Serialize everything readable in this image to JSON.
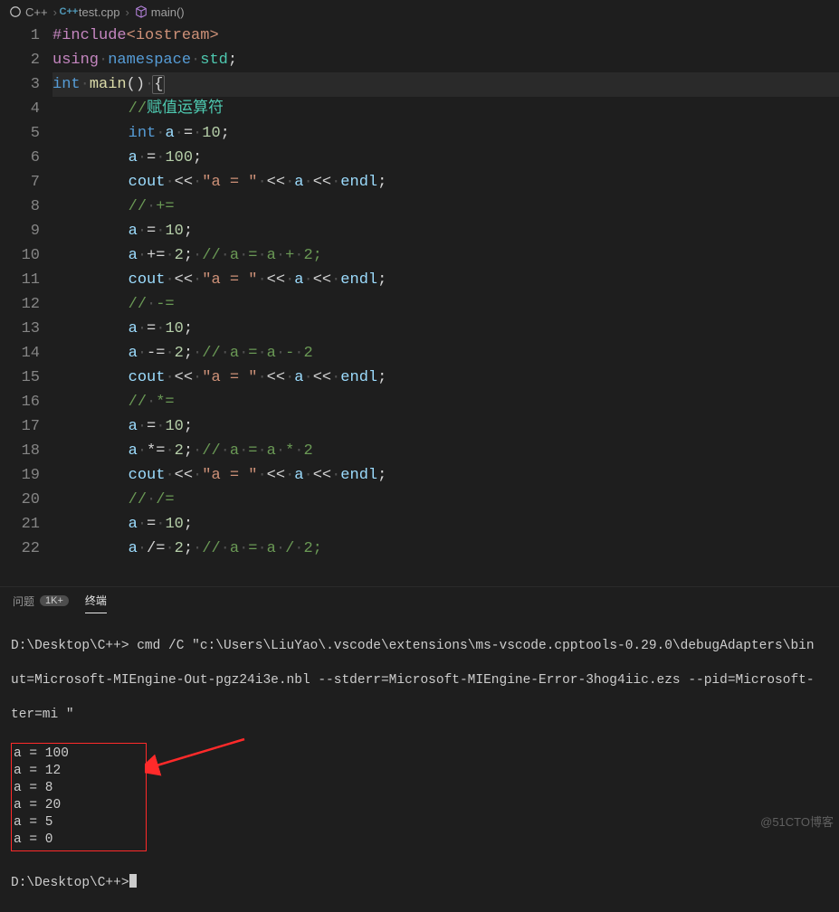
{
  "breadcrumb": {
    "items": [
      {
        "icon": "cpp",
        "label": "C++"
      },
      {
        "icon": "cpp-file",
        "label": "test.cpp"
      },
      {
        "icon": "cube",
        "label": "main()"
      }
    ]
  },
  "editor": {
    "lines": [
      {
        "n": 1,
        "tokens": [
          [
            "pk",
            "#include"
          ],
          [
            "ang",
            "<iostream>"
          ]
        ]
      },
      {
        "n": 2,
        "tokens": [
          [
            "pk",
            "using"
          ],
          [
            "dot",
            "·"
          ],
          [
            "kw",
            "namespace"
          ],
          [
            "dot",
            "·"
          ],
          [
            "ty",
            "std"
          ],
          [
            "pn",
            ";"
          ]
        ]
      },
      {
        "n": 3,
        "tokens": [
          [
            "kw",
            "int"
          ],
          [
            "dot",
            "·"
          ],
          [
            "fn",
            "main"
          ],
          [
            "pn",
            "()"
          ],
          [
            "dot",
            "·"
          ],
          [
            "brmatch",
            "{"
          ]
        ]
      },
      {
        "n": 4,
        "indent": 2,
        "tokens": [
          [
            "cm",
            "//"
          ],
          [
            "cm-cjk",
            "赋值运算符"
          ]
        ]
      },
      {
        "n": 5,
        "indent": 2,
        "tokens": [
          [
            "kw",
            "int"
          ],
          [
            "dot",
            "·"
          ],
          [
            "id",
            "a"
          ],
          [
            "dot",
            "·"
          ],
          [
            "op",
            "="
          ],
          [
            "dot",
            "·"
          ],
          [
            "num",
            "10"
          ],
          [
            "pn",
            ";"
          ]
        ]
      },
      {
        "n": 6,
        "indent": 2,
        "tokens": [
          [
            "id",
            "a"
          ],
          [
            "dot",
            "·"
          ],
          [
            "op",
            "="
          ],
          [
            "dot",
            "·"
          ],
          [
            "num",
            "100"
          ],
          [
            "pn",
            ";"
          ]
        ]
      },
      {
        "n": 7,
        "indent": 2,
        "tokens": [
          [
            "id",
            "cout"
          ],
          [
            "dot",
            "·"
          ],
          [
            "op",
            "<<"
          ],
          [
            "dot",
            "·"
          ],
          [
            "str",
            "\"a = \""
          ],
          [
            "dot",
            "·"
          ],
          [
            "op",
            "<<"
          ],
          [
            "dot",
            "·"
          ],
          [
            "id",
            "a"
          ],
          [
            "dot",
            "·"
          ],
          [
            "op",
            "<<"
          ],
          [
            "dot",
            "·"
          ],
          [
            "id",
            "endl"
          ],
          [
            "pn",
            ";"
          ]
        ]
      },
      {
        "n": 8,
        "indent": 2,
        "tokens": [
          [
            "cm",
            "//"
          ],
          [
            "dot",
            "·"
          ],
          [
            "cm",
            "+="
          ]
        ]
      },
      {
        "n": 9,
        "indent": 2,
        "tokens": [
          [
            "id",
            "a"
          ],
          [
            "dot",
            "·"
          ],
          [
            "op",
            "="
          ],
          [
            "dot",
            "·"
          ],
          [
            "num",
            "10"
          ],
          [
            "pn",
            ";"
          ]
        ]
      },
      {
        "n": 10,
        "indent": 2,
        "tokens": [
          [
            "id",
            "a"
          ],
          [
            "dot",
            "·"
          ],
          [
            "op",
            "+="
          ],
          [
            "dot",
            "·"
          ],
          [
            "num",
            "2"
          ],
          [
            "pn",
            ";"
          ],
          [
            "dot",
            "·"
          ],
          [
            "cm",
            "//"
          ],
          [
            "dot",
            "·"
          ],
          [
            "cm",
            "a"
          ],
          [
            "dot",
            "·"
          ],
          [
            "cm",
            "="
          ],
          [
            "dot",
            "·"
          ],
          [
            "cm",
            "a"
          ],
          [
            "dot",
            "·"
          ],
          [
            "cm",
            "+"
          ],
          [
            "dot",
            "·"
          ],
          [
            "cm",
            "2;"
          ]
        ]
      },
      {
        "n": 11,
        "indent": 2,
        "tokens": [
          [
            "id",
            "cout"
          ],
          [
            "dot",
            "·"
          ],
          [
            "op",
            "<<"
          ],
          [
            "dot",
            "·"
          ],
          [
            "str",
            "\"a = \""
          ],
          [
            "dot",
            "·"
          ],
          [
            "op",
            "<<"
          ],
          [
            "dot",
            "·"
          ],
          [
            "id",
            "a"
          ],
          [
            "dot",
            "·"
          ],
          [
            "op",
            "<<"
          ],
          [
            "dot",
            "·"
          ],
          [
            "id",
            "endl"
          ],
          [
            "pn",
            ";"
          ]
        ]
      },
      {
        "n": 12,
        "indent": 2,
        "tokens": [
          [
            "cm",
            "//"
          ],
          [
            "dot",
            "·"
          ],
          [
            "cm",
            "-="
          ]
        ]
      },
      {
        "n": 13,
        "indent": 2,
        "tokens": [
          [
            "id",
            "a"
          ],
          [
            "dot",
            "·"
          ],
          [
            "op",
            "="
          ],
          [
            "dot",
            "·"
          ],
          [
            "num",
            "10"
          ],
          [
            "pn",
            ";"
          ]
        ]
      },
      {
        "n": 14,
        "indent": 2,
        "tokens": [
          [
            "id",
            "a"
          ],
          [
            "dot",
            "·"
          ],
          [
            "op",
            "-="
          ],
          [
            "dot",
            "·"
          ],
          [
            "num",
            "2"
          ],
          [
            "pn",
            ";"
          ],
          [
            "dot",
            "·"
          ],
          [
            "cm",
            "//"
          ],
          [
            "dot",
            "·"
          ],
          [
            "cm",
            "a"
          ],
          [
            "dot",
            "·"
          ],
          [
            "cm",
            "="
          ],
          [
            "dot",
            "·"
          ],
          [
            "cm",
            "a"
          ],
          [
            "dot",
            "·"
          ],
          [
            "cm",
            "-"
          ],
          [
            "dot",
            "·"
          ],
          [
            "cm",
            "2"
          ]
        ]
      },
      {
        "n": 15,
        "indent": 2,
        "tokens": [
          [
            "id",
            "cout"
          ],
          [
            "dot",
            "·"
          ],
          [
            "op",
            "<<"
          ],
          [
            "dot",
            "·"
          ],
          [
            "str",
            "\"a = \""
          ],
          [
            "dot",
            "·"
          ],
          [
            "op",
            "<<"
          ],
          [
            "dot",
            "·"
          ],
          [
            "id",
            "a"
          ],
          [
            "dot",
            "·"
          ],
          [
            "op",
            "<<"
          ],
          [
            "dot",
            "·"
          ],
          [
            "id",
            "endl"
          ],
          [
            "pn",
            ";"
          ]
        ]
      },
      {
        "n": 16,
        "indent": 2,
        "tokens": [
          [
            "cm",
            "//"
          ],
          [
            "dot",
            "·"
          ],
          [
            "cm",
            "*="
          ]
        ]
      },
      {
        "n": 17,
        "indent": 2,
        "tokens": [
          [
            "id",
            "a"
          ],
          [
            "dot",
            "·"
          ],
          [
            "op",
            "="
          ],
          [
            "dot",
            "·"
          ],
          [
            "num",
            "10"
          ],
          [
            "pn",
            ";"
          ]
        ]
      },
      {
        "n": 18,
        "indent": 2,
        "tokens": [
          [
            "id",
            "a"
          ],
          [
            "dot",
            "·"
          ],
          [
            "op",
            "*="
          ],
          [
            "dot",
            "·"
          ],
          [
            "num",
            "2"
          ],
          [
            "pn",
            ";"
          ],
          [
            "dot",
            "·"
          ],
          [
            "cm",
            "//"
          ],
          [
            "dot",
            "·"
          ],
          [
            "cm",
            "a"
          ],
          [
            "dot",
            "·"
          ],
          [
            "cm",
            "="
          ],
          [
            "dot",
            "·"
          ],
          [
            "cm",
            "a"
          ],
          [
            "dot",
            "·"
          ],
          [
            "cm",
            "*"
          ],
          [
            "dot",
            "·"
          ],
          [
            "cm",
            "2"
          ]
        ]
      },
      {
        "n": 19,
        "indent": 2,
        "tokens": [
          [
            "id",
            "cout"
          ],
          [
            "dot",
            "·"
          ],
          [
            "op",
            "<<"
          ],
          [
            "dot",
            "·"
          ],
          [
            "str",
            "\"a = \""
          ],
          [
            "dot",
            "·"
          ],
          [
            "op",
            "<<"
          ],
          [
            "dot",
            "·"
          ],
          [
            "id",
            "a"
          ],
          [
            "dot",
            "·"
          ],
          [
            "op",
            "<<"
          ],
          [
            "dot",
            "·"
          ],
          [
            "id",
            "endl"
          ],
          [
            "pn",
            ";"
          ]
        ]
      },
      {
        "n": 20,
        "indent": 2,
        "tokens": [
          [
            "cm",
            "//"
          ],
          [
            "dot",
            "·"
          ],
          [
            "cm",
            "/="
          ]
        ]
      },
      {
        "n": 21,
        "indent": 2,
        "tokens": [
          [
            "id",
            "a"
          ],
          [
            "dot",
            "·"
          ],
          [
            "op",
            "="
          ],
          [
            "dot",
            "·"
          ],
          [
            "num",
            "10"
          ],
          [
            "pn",
            ";"
          ]
        ]
      },
      {
        "n": 22,
        "indent": 2,
        "tokens": [
          [
            "id",
            "a"
          ],
          [
            "dot",
            "·"
          ],
          [
            "op",
            "/="
          ],
          [
            "dot",
            "·"
          ],
          [
            "num",
            "2"
          ],
          [
            "pn",
            ";"
          ],
          [
            "dot",
            "·"
          ],
          [
            "cm",
            "//"
          ],
          [
            "dot",
            "·"
          ],
          [
            "cm",
            "a"
          ],
          [
            "dot",
            "·"
          ],
          [
            "cm",
            "="
          ],
          [
            "dot",
            "·"
          ],
          [
            "cm",
            "a"
          ],
          [
            "dot",
            "·"
          ],
          [
            "cm",
            "/"
          ],
          [
            "dot",
            "·"
          ],
          [
            "cm",
            "2;"
          ]
        ]
      }
    ]
  },
  "panel": {
    "tabs": [
      {
        "label": "问题",
        "badge": "1K+"
      },
      {
        "label": "终端",
        "active": true
      }
    ]
  },
  "terminal": {
    "prompt1": "D:\\Desktop\\C++>",
    "cmd": " cmd /C \"c:\\Users\\LiuYao\\.vscode\\extensions\\ms-vscode.cpptools-0.29.0\\debugAdapters\\bin",
    "cmd2": "ut=Microsoft-MIEngine-Out-pgz24i3e.nbl --stderr=Microsoft-MIEngine-Error-3hog4iic.ezs --pid=Microsoft-",
    "cmd3": "ter=mi \"",
    "output": [
      "a = 100",
      "a = 12",
      "a = 8",
      "a = 20",
      "a = 5",
      "a = 0"
    ],
    "prompt2": "D:\\Desktop\\C++>"
  },
  "watermark": "@51CTO博客"
}
